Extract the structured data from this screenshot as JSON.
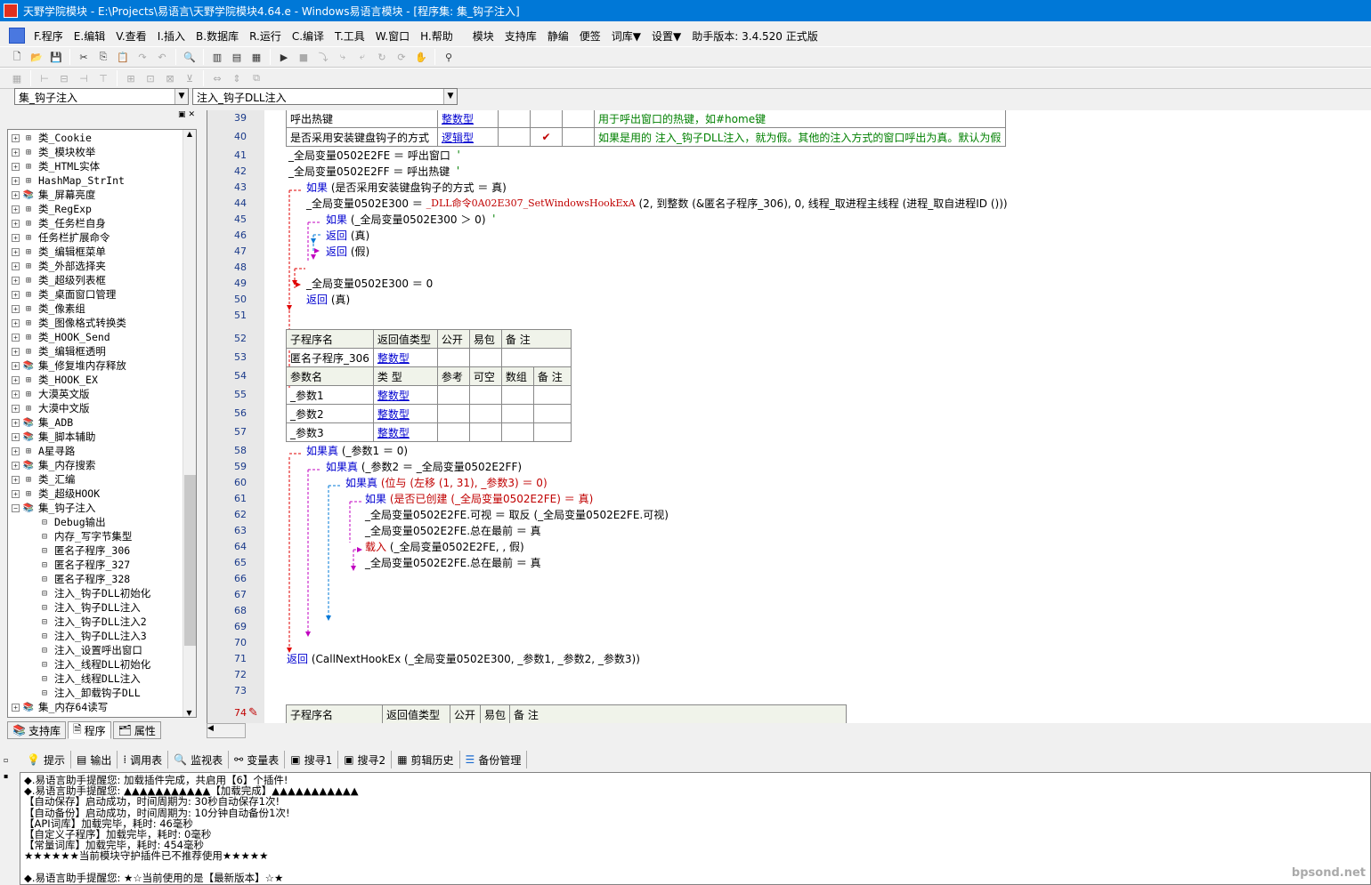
{
  "title": "天野学院模块 - E:\\Projects\\易语言\\天野学院模块4.64.e - Windows易语言模块 - [程序集: 集_钩子注入]",
  "menu": [
    "F.程序",
    "E.编辑",
    "V.查看",
    "I.插入",
    "B.数据库",
    "R.运行",
    "C.编译",
    "T.工具",
    "W.窗口",
    "H.帮助",
    "模块",
    "支持库",
    "静编",
    "便签",
    "词库▼",
    "设置▼",
    "助手版本: 3.4.520 正式版"
  ],
  "combo_left": "集_钩子注入",
  "combo_right": "注入_钩子DLL注入",
  "tree": [
    {
      "label": "类_Cookie"
    },
    {
      "label": "类_模块枚举"
    },
    {
      "label": "类_HTML实体"
    },
    {
      "label": "HashMap_StrInt"
    },
    {
      "label": "集_屏幕亮度"
    },
    {
      "label": "类_RegExp"
    },
    {
      "label": "类_任务栏自身"
    },
    {
      "label": "任务栏扩展命令"
    },
    {
      "label": "类_编辑框菜单"
    },
    {
      "label": "类_外部选择夹"
    },
    {
      "label": "类_超级列表框"
    },
    {
      "label": "类_桌面窗口管理"
    },
    {
      "label": "类_像素组"
    },
    {
      "label": "类_图像格式转换类"
    },
    {
      "label": "类_HOOK_Send"
    },
    {
      "label": "类_编辑框透明"
    },
    {
      "label": "集_修复堆内存释放"
    },
    {
      "label": "类_HOOK_EX"
    },
    {
      "label": "大漠英文版"
    },
    {
      "label": "大漠中文版"
    },
    {
      "label": "集_ADB"
    },
    {
      "label": "集_脚本辅助"
    },
    {
      "label": "A星寻路"
    },
    {
      "label": "集_内存搜索"
    },
    {
      "label": "类_汇编"
    },
    {
      "label": "类_超级HOOK"
    },
    {
      "label": "集_钩子注入"
    }
  ],
  "tree_children": [
    "Debug输出",
    "内存_写字节集型",
    "匿名子程序_306",
    "匿名子程序_327",
    "匿名子程序_328",
    "注入_钩子DLL初始化",
    "注入_钩子DLL注入",
    "注入_钩子DLL注入2",
    "注入_钩子DLL注入3",
    "注入_设置呼出窗口",
    "注入_线程DLL初始化",
    "注入_线程DLL注入",
    "注入_卸载钩子DLL"
  ],
  "tree_last": "集_内存64读写",
  "left_tabs": [
    "支持库",
    "程序",
    "属性"
  ],
  "line_numbers": [
    "39",
    "40",
    "41",
    "42",
    "43",
    "44",
    "45",
    "46",
    "47",
    "48",
    "49",
    "50",
    "51",
    "52",
    "53",
    "54",
    "55",
    "56",
    "57",
    "58",
    "59",
    "60",
    "61",
    "62",
    "63",
    "64",
    "65",
    "66",
    "67",
    "68",
    "69",
    "70",
    "71",
    "72",
    "73",
    "74"
  ],
  "table1": [
    [
      "呼出热键",
      "整数型",
      "",
      "",
      "",
      "用于呼出窗口的热键，如#home键"
    ],
    [
      "是否采用安装键盘钩子的方式",
      "逻辑型",
      "",
      "✔",
      "",
      "如果是用的 注入_钩子DLL注入，就为假。其他的注入方式的窗口呼出为真。默认为假"
    ]
  ],
  "code": {
    "l41": "_全局变量0502E2FE ＝ 呼出窗口",
    "l42": "_全局变量0502E2FF ＝ 呼出热键",
    "l43a": "如果",
    "l43b": "(是否采用安装键盘钩子的方式 ＝ 真)",
    "l44a": "_全局变量0502E300 ＝",
    "l44b": "_DLL命令0A02E307_SetWindowsHookExA",
    "l44c": "(2, 到整数 (&匿名子程序_306), 0, 线程_取进程主线程 (进程_取自进程ID ()))",
    "l45a": "如果",
    "l45b": "(_全局变量0502E300 ＞ 0)",
    "l46a": "返回",
    "l46b": "(真)",
    "l47a": "返回",
    "l47b": "(假)",
    "l49": "_全局变量0502E300 ＝ 0",
    "l50a": "返回",
    "l50b": "(真)",
    "l58a": "如果真",
    "l58b": "(_参数1 ＝ 0)",
    "l59a": "如果真",
    "l59b": "(_参数2 ＝ _全局变量0502E2FF)",
    "l60a": "如果真",
    "l60b": "(位与 (左移 (1, 31), _参数3) ＝ 0)",
    "l61a": "如果",
    "l61b": "(是否已创建 (_全局变量0502E2FE) ＝ 真)",
    "l62": "_全局变量0502E2FE.可视 ＝ 取反 (_全局变量0502E2FE.可视)",
    "l63": "_全局变量0502E2FE.总在最前 ＝ 真",
    "l64a": "载入",
    "l64b": "(_全局变量0502E2FE, , 假)",
    "l65": "_全局变量0502E2FE.总在最前 ＝ 真",
    "l71a": "返回",
    "l71b": "(CallNextHookEx (_全局变量0502E300, _参数1, _参数2, _参数3))"
  },
  "table2": {
    "header": [
      "子程序名",
      "返回值类型",
      "公开",
      "易包",
      "备 注"
    ],
    "row": [
      "匿名子程序_306",
      "整数型",
      "",
      "",
      ""
    ],
    "param_header": [
      "参数名",
      "类 型",
      "参考",
      "可空",
      "数组",
      "备 注"
    ],
    "params": [
      [
        "_参数1",
        "整数型"
      ],
      [
        "_参数2",
        "整数型"
      ],
      [
        "_参数3",
        "整数型"
      ]
    ]
  },
  "table3_header": [
    "子程序名",
    "返回值类型",
    "公开",
    "易包",
    "备 注"
  ],
  "bottom_tabs": [
    "提示",
    "输出",
    "调用表",
    "监视表",
    "变量表",
    "搜寻1",
    "搜寻2",
    "剪辑历史",
    "备份管理"
  ],
  "output_lines": [
    "◆.易语言助手提醒您: 加载插件完成，共启用【6】个插件!",
    "◆.易语言助手提醒您: ▲▲▲▲▲▲▲▲▲▲▲【加载完成】▲▲▲▲▲▲▲▲▲▲▲",
    "【自动保存】启动成功，时间周期为: 30秒自动保存1次!",
    "【自动备份】启动成功，时间周期为: 10分钟自动备份1次!",
    "【API词库】加载完毕，耗时: 46毫秒",
    "【自定义子程序】加载完毕，耗时: 0毫秒",
    "【常量词库】加载完毕，耗时: 454毫秒",
    "★★★★★★当前模块守护插件已不推荐使用★★★★★",
    "",
    "◆.易语言助手提醒您: ★☆当前使用的是【最新版本】☆★"
  ],
  "watermark": "bpsond.net"
}
